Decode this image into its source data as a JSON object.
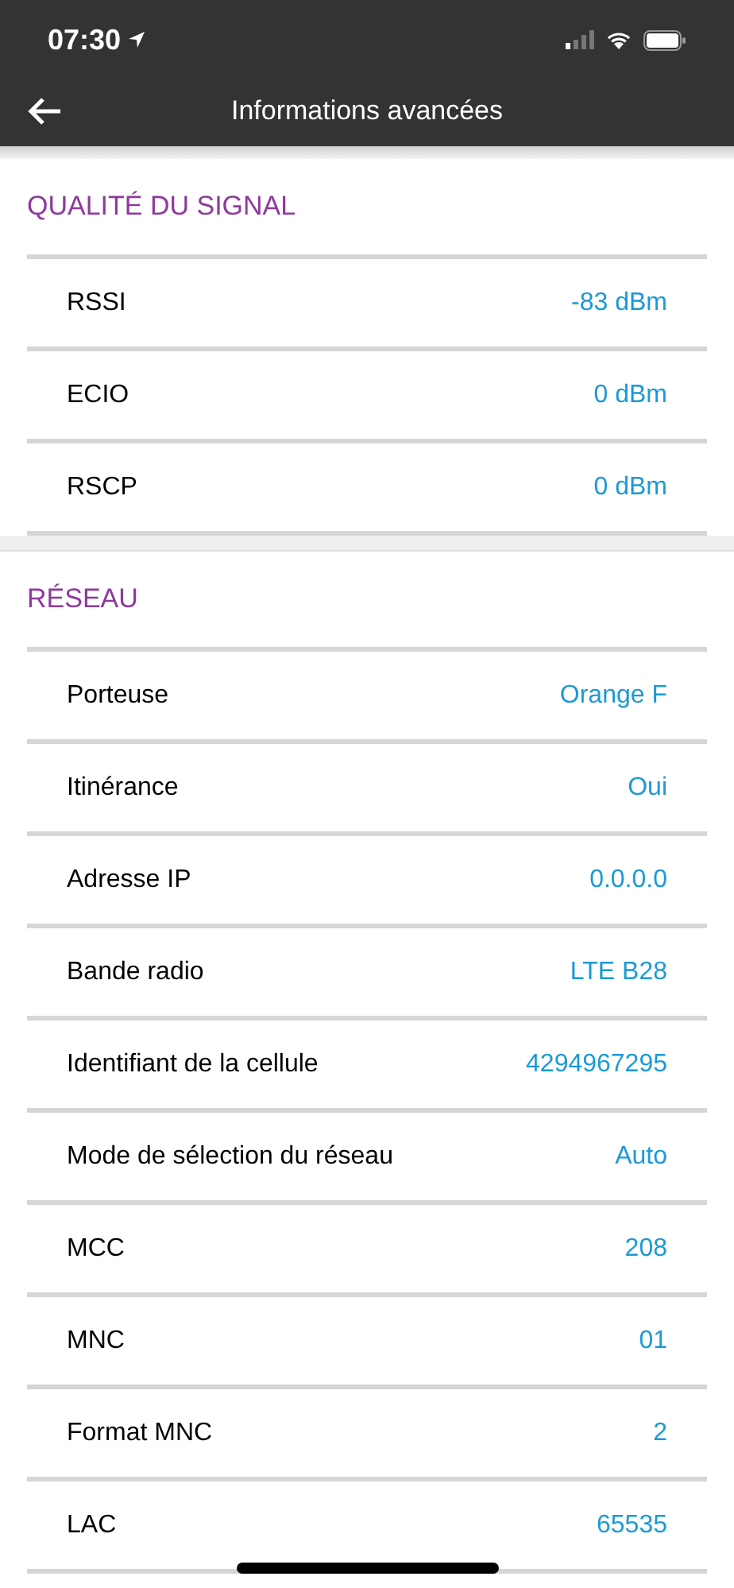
{
  "status_bar": {
    "time": "07:30"
  },
  "header": {
    "title": "Informations avancées"
  },
  "sections": [
    {
      "title": "QUALITÉ DU SIGNAL",
      "rows": [
        {
          "label": "RSSI",
          "value": "-83 dBm"
        },
        {
          "label": "ECIO",
          "value": "0 dBm"
        },
        {
          "label": "RSCP",
          "value": "0 dBm"
        }
      ]
    },
    {
      "title": "RÉSEAU",
      "rows": [
        {
          "label": "Porteuse",
          "value": "Orange F"
        },
        {
          "label": "Itinérance",
          "value": "Oui"
        },
        {
          "label": "Adresse IP",
          "value": "0.0.0.0"
        },
        {
          "label": "Bande radio",
          "value": "LTE B28"
        },
        {
          "label": "Identifiant de la cellule",
          "value": "4294967295"
        },
        {
          "label": "Mode de sélection du réseau",
          "value": "Auto"
        },
        {
          "label": "MCC",
          "value": "208"
        },
        {
          "label": "MNC",
          "value": "01"
        },
        {
          "label": "Format MNC",
          "value": "2"
        },
        {
          "label": "LAC",
          "value": "65535"
        }
      ]
    }
  ]
}
